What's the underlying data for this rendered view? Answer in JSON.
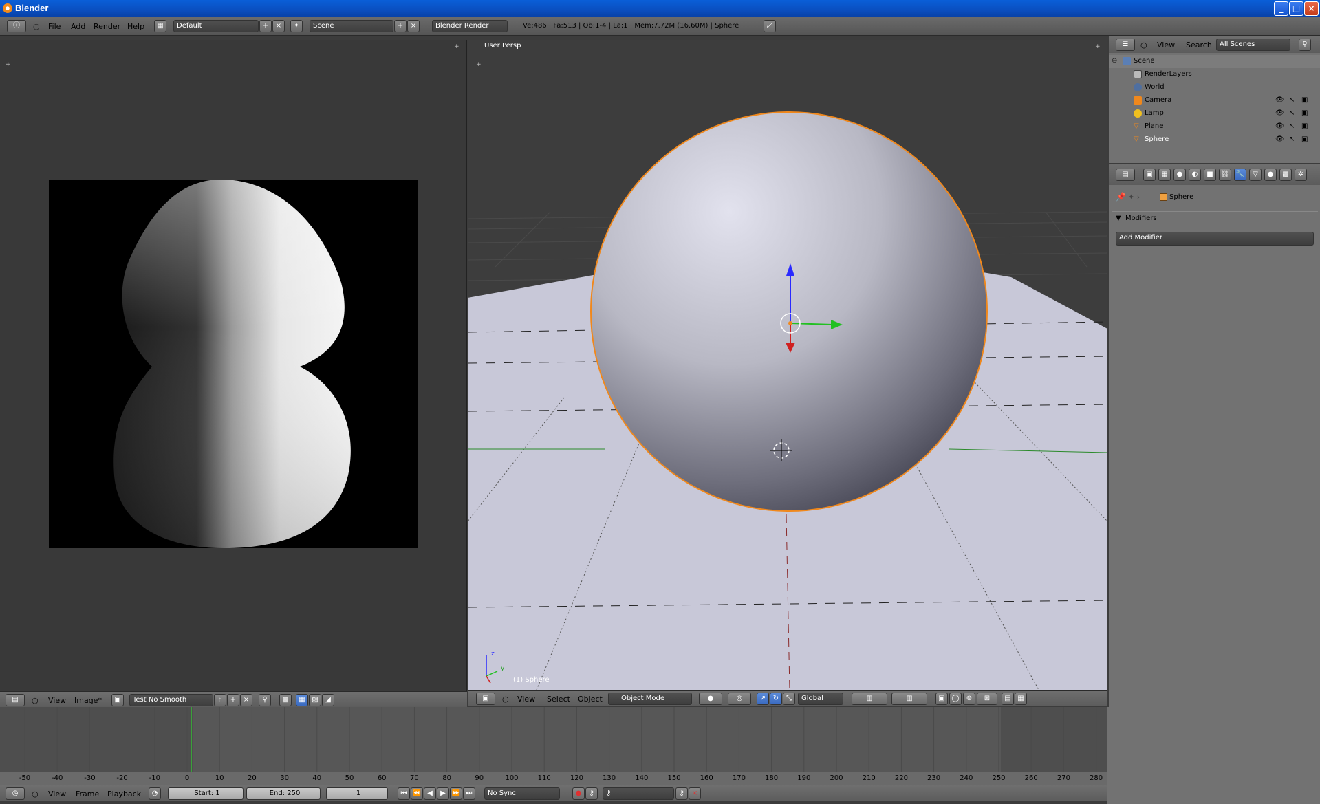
{
  "window": {
    "title": "Blender"
  },
  "topbar": {
    "menus": [
      "File",
      "Add",
      "Render",
      "Help"
    ],
    "layout": "Default",
    "scene": "Scene",
    "engine": "Blender Render",
    "stats": "Ve:486 | Fa:513 | Ob:1-4 | La:1 | Mem:7.72M (16.60M) | Sphere"
  },
  "image_editor": {
    "menus": [
      "View",
      "Image*"
    ],
    "image_name": "Test No Smooth",
    "fake_user": "F"
  },
  "viewport": {
    "label": "User Persp",
    "object_label": "(1) Sphere",
    "menus": [
      "View",
      "Select",
      "Object"
    ],
    "mode": "Object Mode",
    "orientation": "Global",
    "axis_x": "x",
    "axis_y": "y",
    "axis_z": "z"
  },
  "outliner": {
    "menus": [
      "View",
      "Search"
    ],
    "filter": "All Scenes",
    "items": [
      {
        "label": "Scene",
        "icon": "scene-icon"
      },
      {
        "label": "RenderLayers",
        "icon": "render-layers-icon"
      },
      {
        "label": "World",
        "icon": "world-icon"
      },
      {
        "label": "Camera",
        "icon": "camera-icon"
      },
      {
        "label": "Lamp",
        "icon": "lamp-icon"
      },
      {
        "label": "Plane",
        "icon": "mesh-icon"
      },
      {
        "label": "Sphere",
        "icon": "mesh-icon"
      }
    ]
  },
  "properties": {
    "breadcrumb_object": "Sphere",
    "panel_title": "Modifiers",
    "add_modifier": "Add Modifier"
  },
  "timeline": {
    "ticks": [
      "-50",
      "-40",
      "-30",
      "-20",
      "-10",
      "0",
      "10",
      "20",
      "30",
      "40",
      "50",
      "60",
      "70",
      "80",
      "90",
      "100",
      "110",
      "120",
      "130",
      "140",
      "150",
      "160",
      "170",
      "180",
      "190",
      "200",
      "210",
      "220",
      "230",
      "240",
      "250",
      "260",
      "270",
      "280"
    ],
    "menus": [
      "View",
      "Frame",
      "Playback"
    ],
    "start": "Start: 1",
    "end": "End: 250",
    "current": "1",
    "sync": "No Sync"
  },
  "colors": {
    "accent": "#5680c2",
    "selection_orange": "#f0881c",
    "header": "#5f5f5f",
    "panel": "#727272"
  }
}
